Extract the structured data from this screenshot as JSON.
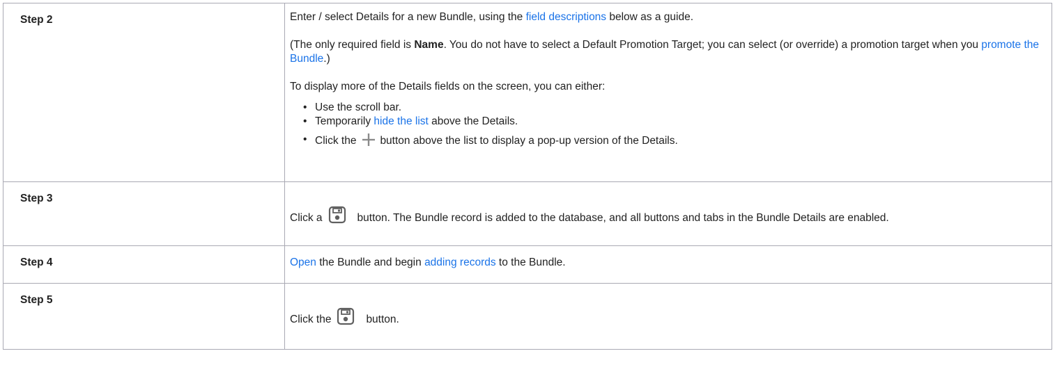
{
  "rows": [
    {
      "step": "Step 2",
      "p1": {
        "before": "Enter / select Details for a new Bundle, using the ",
        "link": "field descriptions",
        "after": " below as a guide."
      },
      "p2": {
        "before": "(The only required field is ",
        "bold": "Name",
        "middle": ". You do not have to select a Default Promotion Target; you can select (or override) a promotion target when you ",
        "link": "promote the Bundle",
        "after": ".)"
      },
      "p3": "To display more of the Details fields on the screen, you can either:",
      "bullets": {
        "b1": "Use the scroll bar.",
        "b2_before": "Temporarily ",
        "b2_link": "hide the list",
        "b2_after": " above the Details.",
        "b3_before": "Click the",
        "b3_after": "button above the list to display a pop-up version of the Details."
      },
      "icon": "plus-icon"
    },
    {
      "step": "Step 3",
      "before": "Click a",
      "after": "button. The Bundle record is added to the database, and all buttons and tabs in the Bundle Details are enabled.",
      "icon": "save-icon"
    },
    {
      "step": "Step 4",
      "link1": "Open",
      "middle": " the Bundle and begin ",
      "link2": "adding records",
      "after": " to the Bundle."
    },
    {
      "step": "Step 5",
      "before": "Click the",
      "after": "button.",
      "icon": "save-icon"
    }
  ],
  "colors": {
    "link": "#1a73e8",
    "border": "#a9a9b3",
    "icon_gray": "#8a8a8a"
  }
}
